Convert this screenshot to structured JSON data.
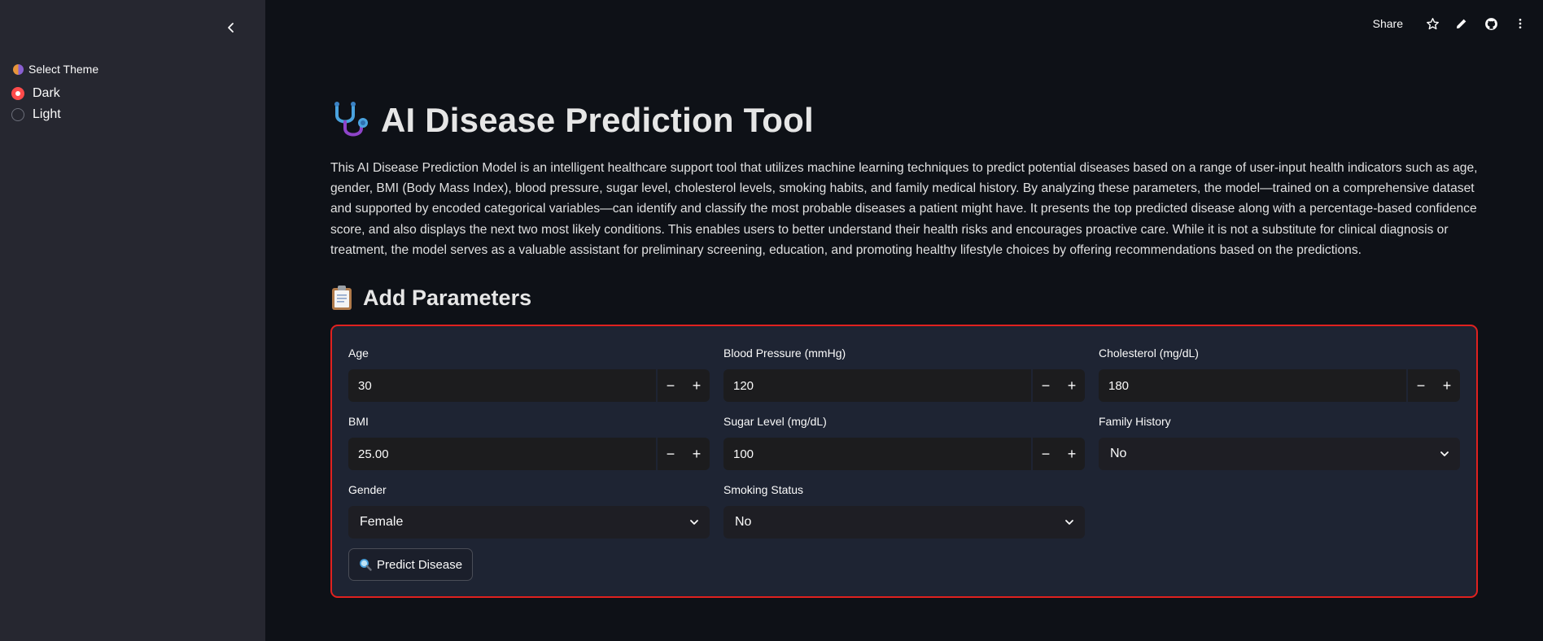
{
  "sidebar": {
    "theme_label": "Select Theme",
    "theme_options": [
      "Dark",
      "Light"
    ],
    "selected_theme": "Dark"
  },
  "toolbar": {
    "share_label": "Share"
  },
  "main": {
    "title": "AI Disease Prediction Tool",
    "description": "This AI Disease Prediction Model is an intelligent healthcare support tool that utilizes machine learning techniques to predict potential diseases based on a range of user-input health indicators such as age, gender, BMI (Body Mass Index), blood pressure, sugar level, cholesterol levels, smoking habits, and family medical history. By analyzing these parameters, the model—trained on a comprehensive dataset and supported by encoded categorical variables—can identify and classify the most probable diseases a patient might have. It presents the top predicted disease along with a percentage-based confidence score, and also displays the next two most likely conditions. This enables users to better understand their health risks and encourages proactive care. While it is not a substitute for clinical diagnosis or treatment, the model serves as a valuable assistant for preliminary screening, education, and promoting healthy lifestyle choices by offering recommendations based on the predictions.",
    "section_title": "Add Parameters"
  },
  "form": {
    "age": {
      "label": "Age",
      "value": "30"
    },
    "blood_pressure": {
      "label": "Blood Pressure (mmHg)",
      "value": "120"
    },
    "cholesterol": {
      "label": "Cholesterol (mg/dL)",
      "value": "180"
    },
    "bmi": {
      "label": "BMI",
      "value": "25.00"
    },
    "sugar": {
      "label": "Sugar Level (mg/dL)",
      "value": "100"
    },
    "family_history": {
      "label": "Family History",
      "value": "No"
    },
    "gender": {
      "label": "Gender",
      "value": "Female"
    },
    "smoking": {
      "label": "Smoking Status",
      "value": "No"
    },
    "minus": "−",
    "plus": "+",
    "predict_label": "Predict Disease"
  },
  "colors": {
    "accent": "#ff4b4b",
    "form_border": "#e0211f",
    "sidebar_bg": "#262730",
    "page_bg": "#0e1117"
  }
}
